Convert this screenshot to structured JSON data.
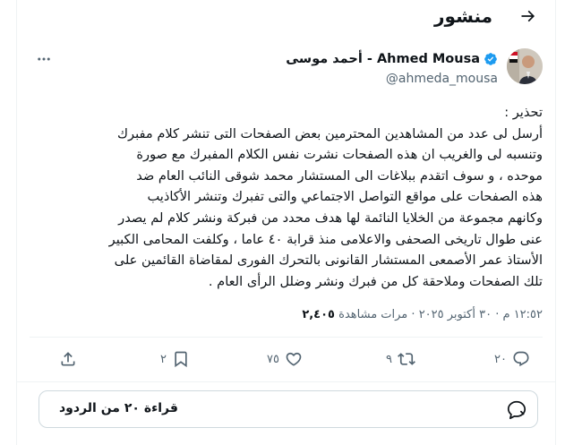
{
  "header": {
    "title": "منشور",
    "back_icon": "arrow-right-icon"
  },
  "author": {
    "display_name": "Ahmed Mousa - أحمد موسى",
    "handle": "@ahmeda_mousa",
    "verified": true,
    "verified_color": "#1d9bf0"
  },
  "post": {
    "lines": [
      "تحذير :",
      "أرسل لى عدد من المشاهدين المحترمين بعض الصفحات التى تنشر كلام مفبرك",
      "وتنسبه  لى والغريب ان هذه الصفحات نشرت نفس الكلام المفبرك مع صورة",
      "موحده ، و سوف اتقدم ببلاغات  الى المستشار محمد شوقى النائب العام ضد",
      "هذه الصفحات على مواقع التواصل الاجتماعي والتى تفبرك وتنشر  الأكاذيب",
      "وكانهم مجموعة من الخلايا النائمة لها هدف محدد من فبركة ونشر كلام لم يصدر",
      "عنى طوال تاريخى الصحفى والاعلامى منذ قرابة ٤٠ عاما ، وكلفت المحامى الكبير",
      "الأستاذ عمر الأصمعى المستشار  القانونى بالتحرك الفورى لمقاضاة القائمين على",
      "تلك الصفحات وملاحقة كل من فبرك ونشر وضلل الرأى العام ."
    ]
  },
  "meta": {
    "time": "١٢:٥٢ م",
    "date": "٣٠ أكتوبر ٢٠٢٥",
    "separator": " · ",
    "views_count": "٢,٤٠٥",
    "views_label": " مرات مشاهدة"
  },
  "actions": {
    "replies": "٢٠",
    "reposts": "٩",
    "likes": "٧٥",
    "bookmarks": "٢"
  },
  "read_replies": {
    "label": "قراءة ٢٠ من الردود"
  },
  "colors": {
    "text": "#0f1419",
    "secondary": "#536471",
    "border": "#cfd9de",
    "divider": "#eff3f4"
  }
}
